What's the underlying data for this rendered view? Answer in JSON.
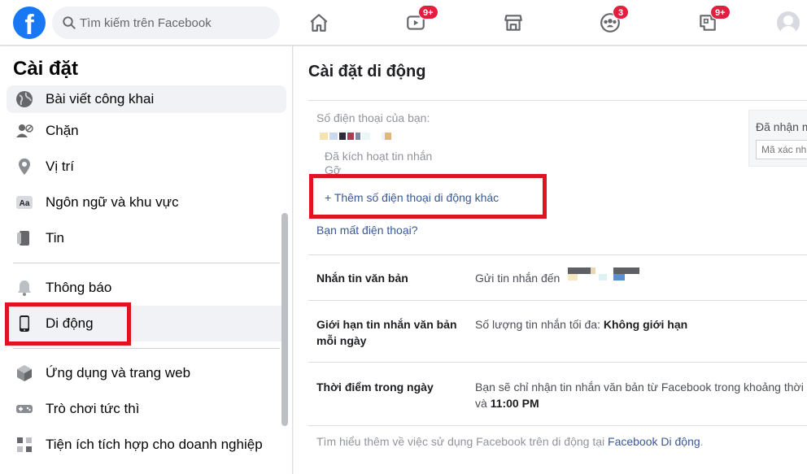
{
  "header": {
    "logo": "f",
    "search": {
      "placeholder": "Tìm kiếm trên Facebook"
    },
    "nav": [
      {
        "name": "home",
        "badge": ""
      },
      {
        "name": "watch",
        "badge": "9+"
      },
      {
        "name": "marketplace",
        "badge": ""
      },
      {
        "name": "groups",
        "badge": "3"
      },
      {
        "name": "gaming",
        "badge": "9+"
      }
    ]
  },
  "sidebar": {
    "title": "Cài đặt",
    "items": [
      {
        "label": "Bài viết công khai",
        "icon": "globe-icon"
      },
      {
        "label": "Chặn",
        "icon": "block-user-icon"
      },
      {
        "label": "Vị trí",
        "icon": "location-pin-icon"
      },
      {
        "label": "Ngôn ngữ và khu vực",
        "icon": "language-icon"
      },
      {
        "label": "Tin",
        "icon": "stories-icon"
      },
      {
        "label": "Thông báo",
        "icon": "bell-icon"
      },
      {
        "label": "Di động",
        "icon": "mobile-phone-icon"
      },
      {
        "label": "Ứng dụng và trang web",
        "icon": "apps-cube-icon"
      },
      {
        "label": "Trò chơi tức thì",
        "icon": "gamepad-icon"
      },
      {
        "label": "Tiện ích tích hợp cho doanh nghiệp",
        "icon": "business-integration-icon"
      }
    ]
  },
  "main": {
    "title": "Cài đặt di động",
    "phone_label": "Số điện thoại của bạn:",
    "activated": "Đã kích hoạt tin nhắn",
    "remove": "Gỡ",
    "add_phone": "+ Thêm số điện thoại di động khác",
    "lost_phone": "Bạn mất điện thoại?",
    "verify": {
      "label": "Đã nhận mã",
      "placeholder": "Mã xác nhận"
    },
    "rows": [
      {
        "label": "Nhắn tin văn bản",
        "value_prefix": "Gửi tin nhắn đến",
        "value_bold": "",
        "value_suffix": ""
      },
      {
        "label": "Giới hạn tin nhắn văn bản mỗi ngày",
        "value_prefix": "Số lượng tin nhắn tối đa: ",
        "value_bold": "Không giới hạn",
        "value_suffix": ""
      },
      {
        "label": "Thời điểm trong ngày",
        "value_prefix": "Bạn sẽ chỉ nhận tin nhắn văn bản từ Facebook trong khoảng thời gian từ",
        "value_bold": "11:00 PM",
        "value_suffix": ""
      }
    ],
    "row3_line2_prefix": "và ",
    "footer": {
      "text": "Tìm hiểu thêm về việc sử dụng Facebook trên di động tại ",
      "link": "Facebook Di động",
      "end": "."
    }
  },
  "colors": {
    "brand": "#1877f2",
    "link": "#385898",
    "highlight": "#e0141e",
    "badge": "#e41e3f"
  }
}
